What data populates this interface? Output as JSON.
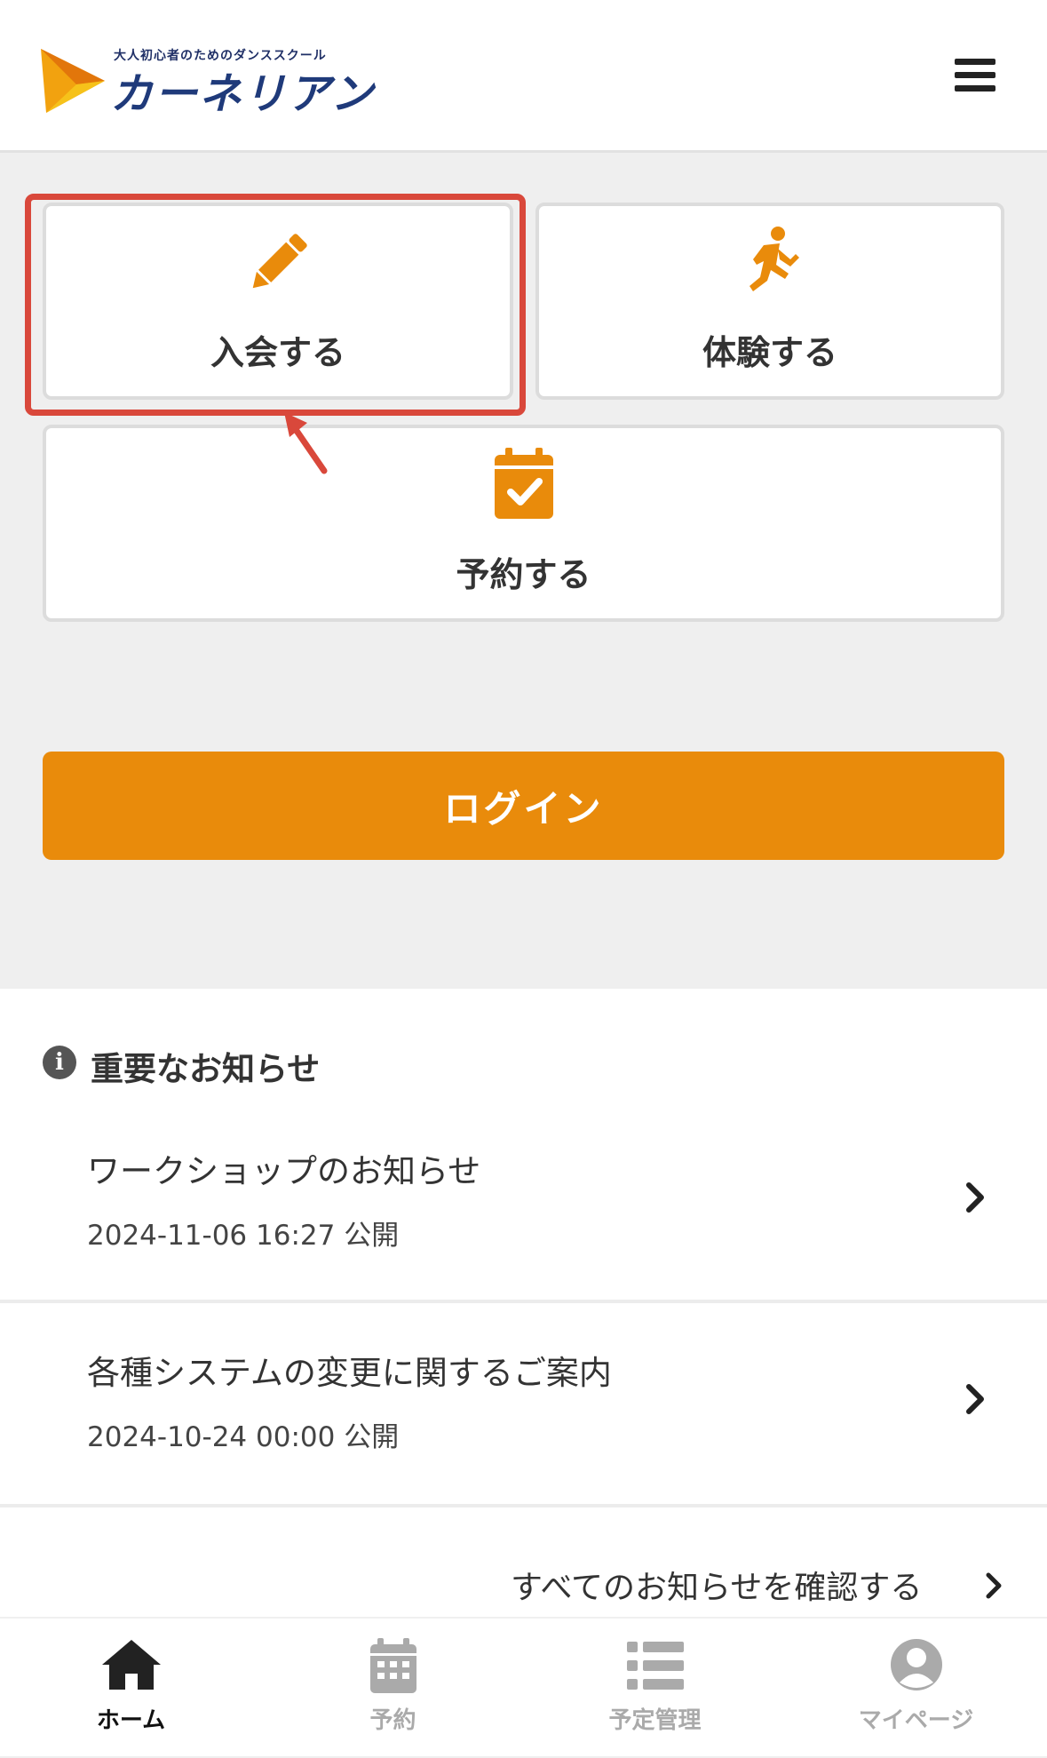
{
  "header": {
    "logo_tagline": "大人初心者のためのダンススクール",
    "logo_name": "カーネリアン",
    "menu_icon": "hamburger-menu-icon"
  },
  "actions": {
    "join": {
      "label": "入会する",
      "icon": "pencil-icon"
    },
    "trial": {
      "label": "体験する",
      "icon": "running-person-icon"
    },
    "reserve": {
      "label": "予約する",
      "icon": "calendar-check-icon"
    }
  },
  "login": {
    "label": "ログイン"
  },
  "notices": {
    "title": "重要なお知らせ",
    "items": [
      {
        "title": "ワークショップのお知らせ",
        "date": "2024-11-06 16:27 公開"
      },
      {
        "title": "各種システムの変更に関するご案内",
        "date": "2024-10-24 00:00 公開"
      }
    ],
    "see_all": "すべてのお知らせを確認する"
  },
  "tabbar": {
    "home": "ホーム",
    "reserve": "予約",
    "schedule": "予定管理",
    "mypage": "マイページ"
  },
  "colors": {
    "accent": "#e98b0b",
    "highlight": "#d9483b",
    "brand_navy": "#1f3a7a"
  }
}
